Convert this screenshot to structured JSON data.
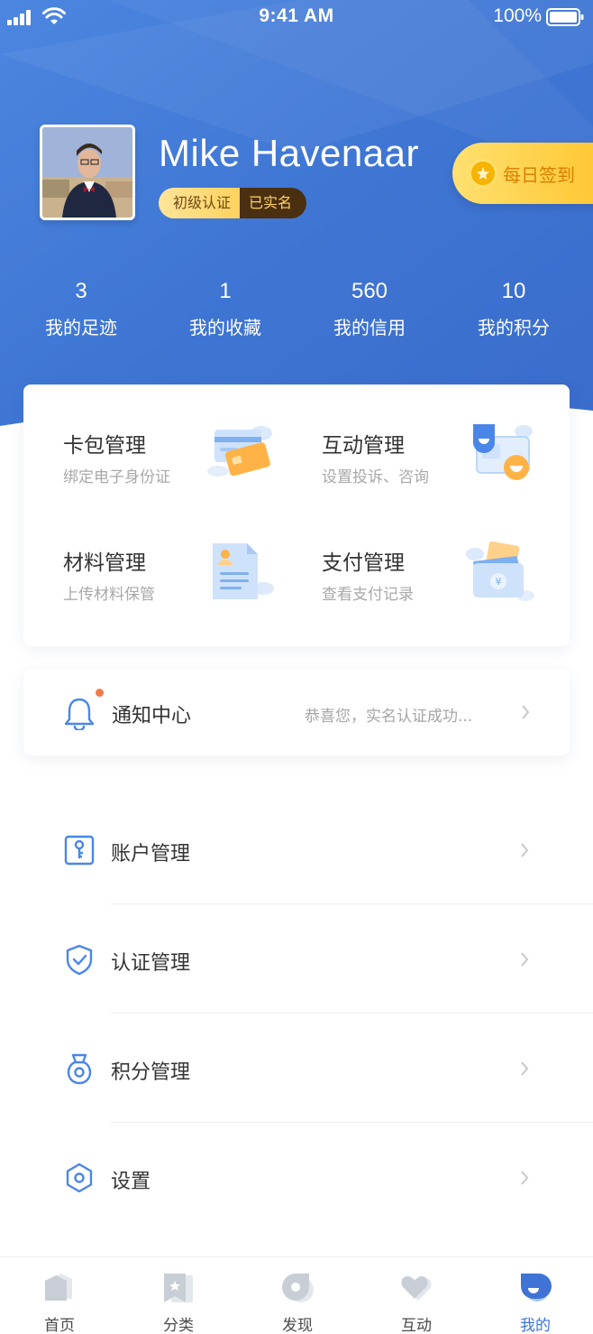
{
  "status_bar": {
    "time": "9:41 AM",
    "battery": "100%"
  },
  "profile": {
    "name": "Mike Havenaar",
    "badge_level": "初级认证",
    "badge_verified": "已实名",
    "checkin_label": "每日签到"
  },
  "stats": [
    {
      "value": "3",
      "label": "我的足迹"
    },
    {
      "value": "1",
      "label": "我的收藏"
    },
    {
      "value": "560",
      "label": "我的信用"
    },
    {
      "value": "10",
      "label": "我的积分"
    }
  ],
  "tools": [
    {
      "title": "卡包管理",
      "subtitle": "绑定电子身份证",
      "icon": "card-wallet-illustration"
    },
    {
      "title": "互动管理",
      "subtitle": "设置投诉、咨询",
      "icon": "chat-bubbles-illustration"
    },
    {
      "title": "材料管理",
      "subtitle": "上传材料保管",
      "icon": "document-illustration"
    },
    {
      "title": "支付管理",
      "subtitle": "查看支付记录",
      "icon": "payment-wallet-illustration"
    }
  ],
  "notice": {
    "title": "通知中心",
    "message": "恭喜您，实名认证成功...",
    "icon": "bell-icon"
  },
  "menu": [
    {
      "label": "账户管理",
      "icon": "account-key-icon"
    },
    {
      "label": "认证管理",
      "icon": "shield-check-icon"
    },
    {
      "label": "积分管理",
      "icon": "medal-icon"
    },
    {
      "label": "设置",
      "icon": "settings-hexagon-icon"
    }
  ],
  "tabs": [
    {
      "label": "首页",
      "icon": "home-icon",
      "active": false
    },
    {
      "label": "分类",
      "icon": "bookmark-star-icon",
      "active": false
    },
    {
      "label": "发现",
      "icon": "discover-icon",
      "active": false
    },
    {
      "label": "互动",
      "icon": "heart-icon",
      "active": false
    },
    {
      "label": "我的",
      "icon": "profile-icon",
      "active": true
    }
  ],
  "colors": {
    "primary": "#3f74d6",
    "hero_start": "#3b6fd0",
    "hero_end": "#4f8ce4",
    "accent_yellow": "#ffc630",
    "notice_dot": "#f27a4a"
  }
}
